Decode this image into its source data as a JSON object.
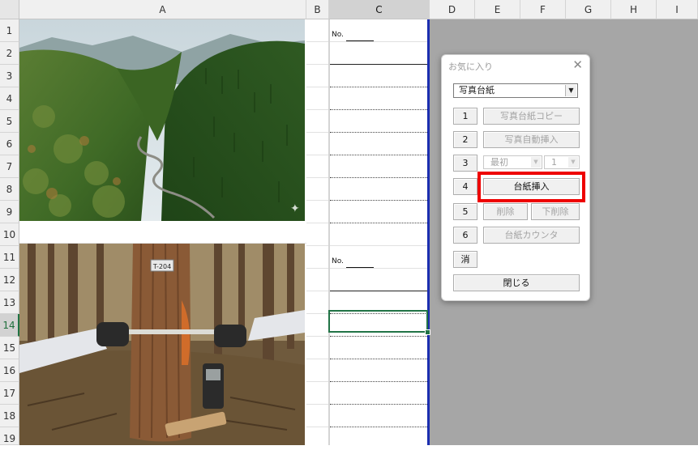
{
  "columns": [
    "A",
    "B",
    "C",
    "D",
    "E",
    "F",
    "G",
    "H",
    "I"
  ],
  "rows": [
    "1",
    "2",
    "3",
    "4",
    "5",
    "6",
    "7",
    "8",
    "9",
    "10",
    "11",
    "12",
    "13",
    "14",
    "15",
    "16",
    "17",
    "18",
    "19"
  ],
  "photo_tag": "T-204",
  "cells": {
    "no_label_1": "No.",
    "no_label_2": "No."
  },
  "dialog": {
    "title": "お気に入り",
    "close": "✕",
    "dropdown_value": "写真台紙",
    "buttons": {
      "n1": "1",
      "copy": "写真台紙コピー",
      "n2": "2",
      "auto_insert": "写真自動挿入",
      "n3": "3",
      "first": "最初",
      "first_num": "1",
      "n4": "4",
      "insert": "台紙挿入",
      "n5": "5",
      "delete": "削除",
      "delete_below": "下削除",
      "n6": "6",
      "counter": "台紙カウンタ",
      "clear": "消",
      "close_btn": "閉じる"
    }
  },
  "colors": {
    "highlight": "#ee0000",
    "active_cell": "#217346",
    "print_border": "#1c2eb0"
  }
}
